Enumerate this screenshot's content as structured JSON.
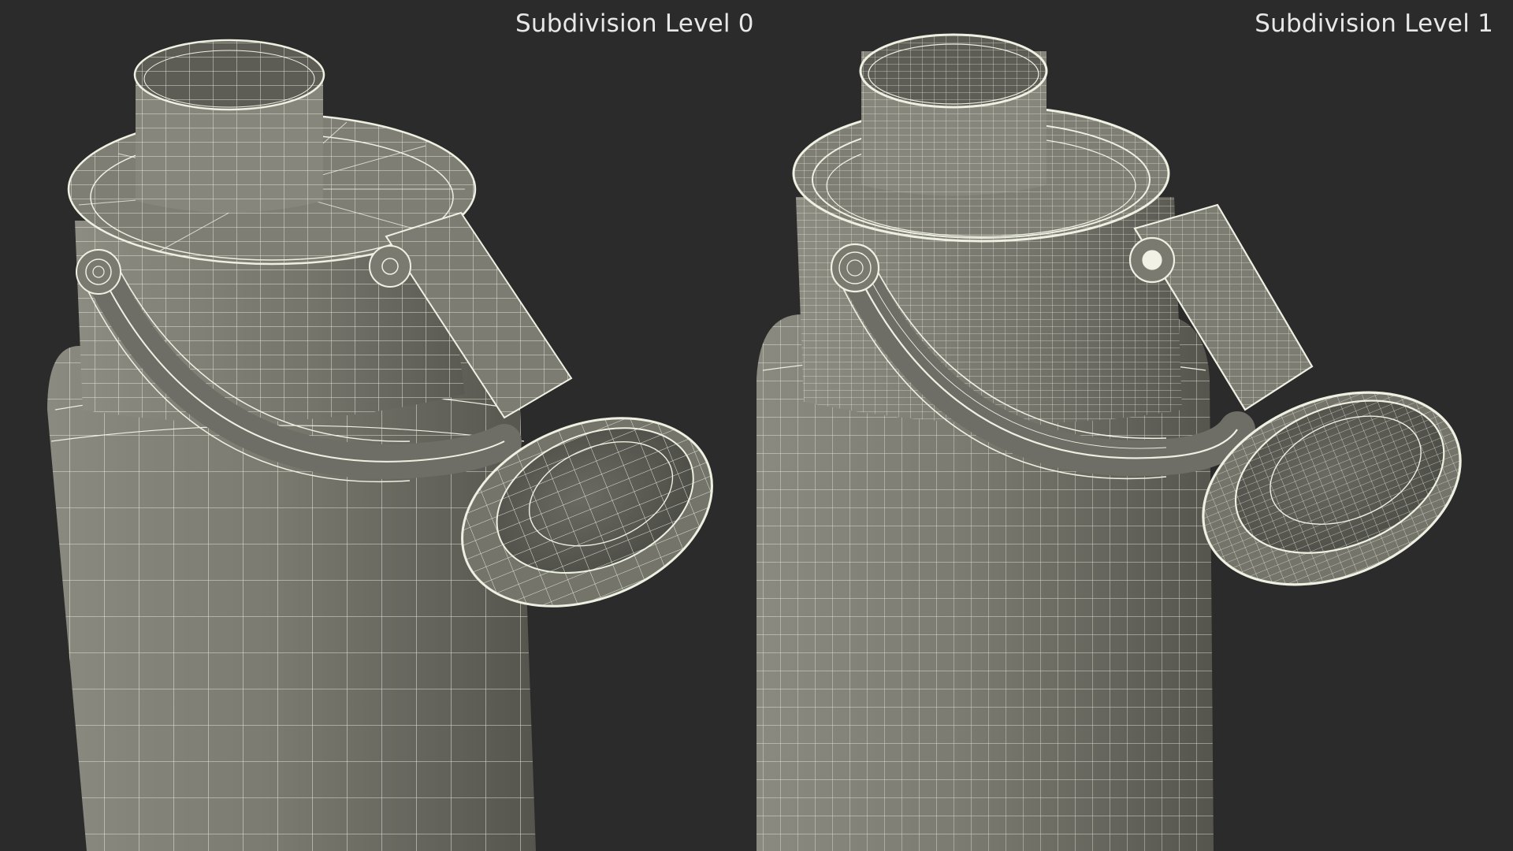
{
  "panels": [
    {
      "label": "Subdivision Level 0"
    },
    {
      "label": "Subdivision Level 1"
    }
  ],
  "colors": {
    "background": "#2b2b2b",
    "surface": "#7a7a70",
    "surface_dark": "#5f5f57",
    "wire": "#eef0e2",
    "label": "#e8e8e8"
  }
}
